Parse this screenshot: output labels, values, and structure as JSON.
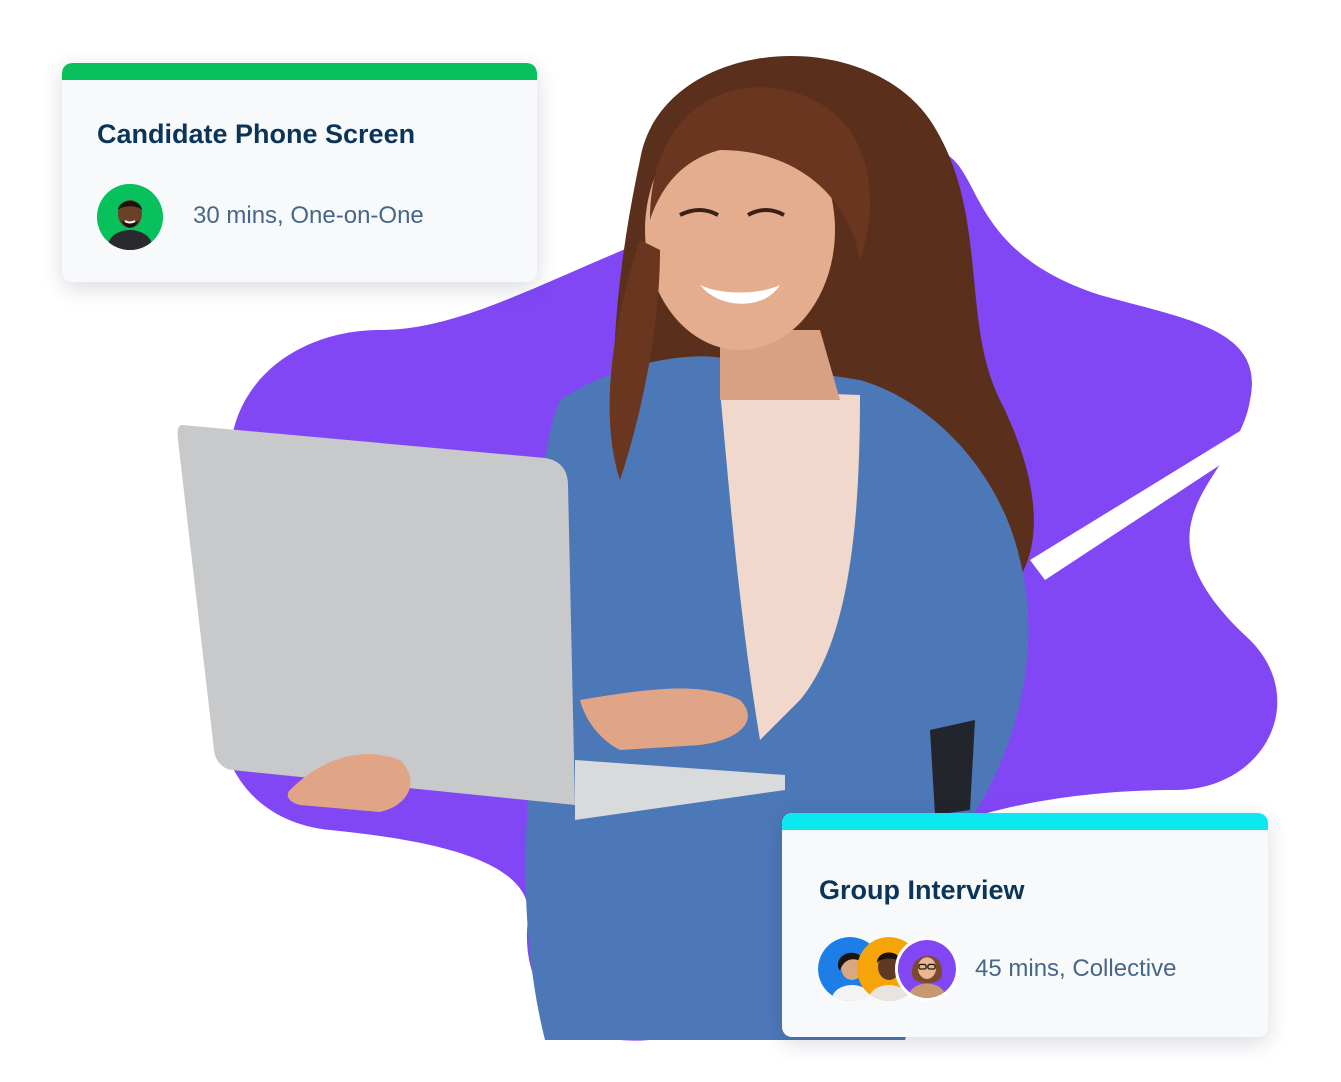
{
  "cards": {
    "phone_screen": {
      "title": "Candidate Phone Screen",
      "meta": "30 mins, One-on-One",
      "bar_color": "#08c15c"
    },
    "group_interview": {
      "title": "Group Interview",
      "meta": "45 mins, Collective",
      "bar_color": "#0ae8f0"
    }
  },
  "colors": {
    "blob": "#8247f5",
    "title": "#0b3558",
    "meta": "#476788"
  },
  "icons": {
    "host_avatar": "avatar-man-icon",
    "group_avatars": [
      "avatar-woman-blue-icon",
      "avatar-woman-orange-icon",
      "avatar-woman-purple-icon"
    ]
  }
}
